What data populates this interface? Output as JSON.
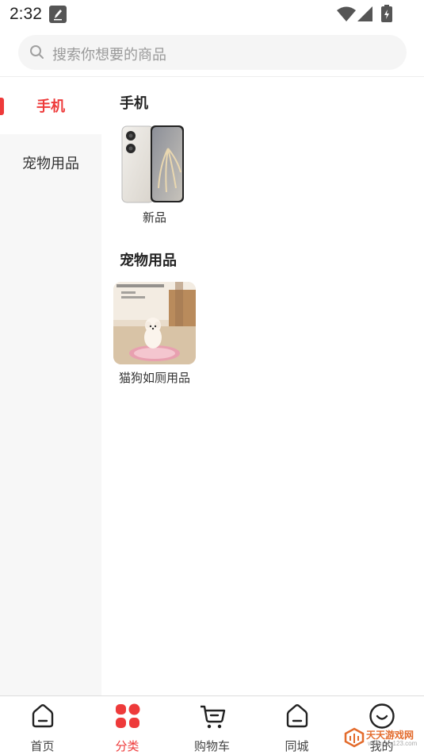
{
  "status_bar": {
    "time": "2:32"
  },
  "search": {
    "placeholder": "搜索你想要的商品"
  },
  "sidebar": {
    "items": [
      {
        "label": "手机",
        "active": true
      },
      {
        "label": "宠物用品",
        "active": false
      }
    ]
  },
  "sections": [
    {
      "title": "手机",
      "products": [
        {
          "name": "新品"
        }
      ]
    },
    {
      "title": "宠物用品",
      "products": [
        {
          "name": "猫狗如厕用品"
        }
      ]
    }
  ],
  "bottom_nav": {
    "items": [
      {
        "label": "首页",
        "icon": "home-icon",
        "active": false
      },
      {
        "label": "分类",
        "icon": "category-icon",
        "active": true
      },
      {
        "label": "购物车",
        "icon": "cart-icon",
        "active": false
      },
      {
        "label": "同城",
        "icon": "local-icon",
        "active": false
      },
      {
        "label": "我的",
        "icon": "profile-icon",
        "active": false
      }
    ]
  },
  "watermark": {
    "text": "天天游戏网",
    "sub": "www.ttyx123.com"
  },
  "colors": {
    "accent": "#ee3a3a",
    "sidebar_bg": "#f7f7f7",
    "search_bg": "#f5f5f5"
  }
}
